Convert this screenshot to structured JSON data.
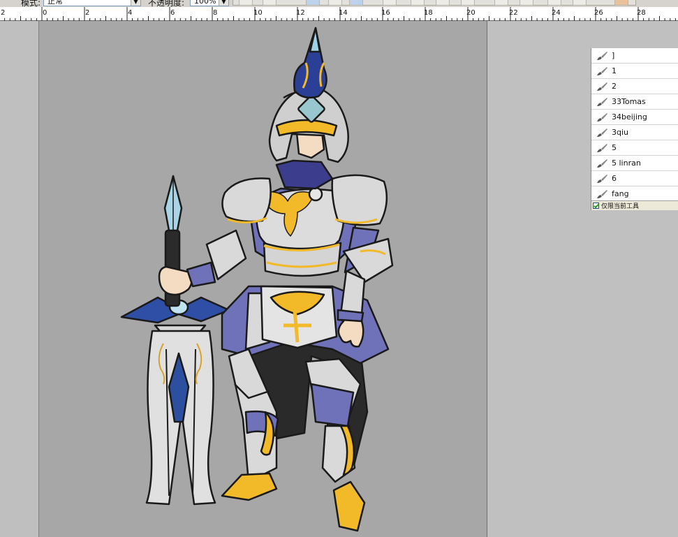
{
  "options_bar": {
    "mode_label": "模式:",
    "mode_value": "正常",
    "opacity_label": "不透明度:",
    "opacity_value": "100%"
  },
  "ruler": {
    "ticks": [
      "2",
      "0",
      "2",
      "4",
      "6",
      "8",
      "10",
      "12",
      "14",
      "16",
      "18",
      "20",
      "22",
      "24",
      "26",
      "28"
    ]
  },
  "tool_presets": {
    "items": [
      "]",
      "1",
      "2",
      "33Tomas",
      "34beijing",
      "3qiu",
      "5",
      "5 linran",
      "6",
      "fang"
    ],
    "current_tool_only_label": "仅限当前工具",
    "current_tool_only_checked": true
  },
  "colors": {
    "canvas": "#a7a7a7",
    "pasteboard": "#c0c0c0",
    "armor_blue": "#6f72b8",
    "gold": "#f2b928",
    "silver": "#d9d9d9",
    "navy": "#2a3f95"
  },
  "icons": {
    "preset": "brush-preset-icon",
    "dropdown": "chevron-down-icon"
  }
}
